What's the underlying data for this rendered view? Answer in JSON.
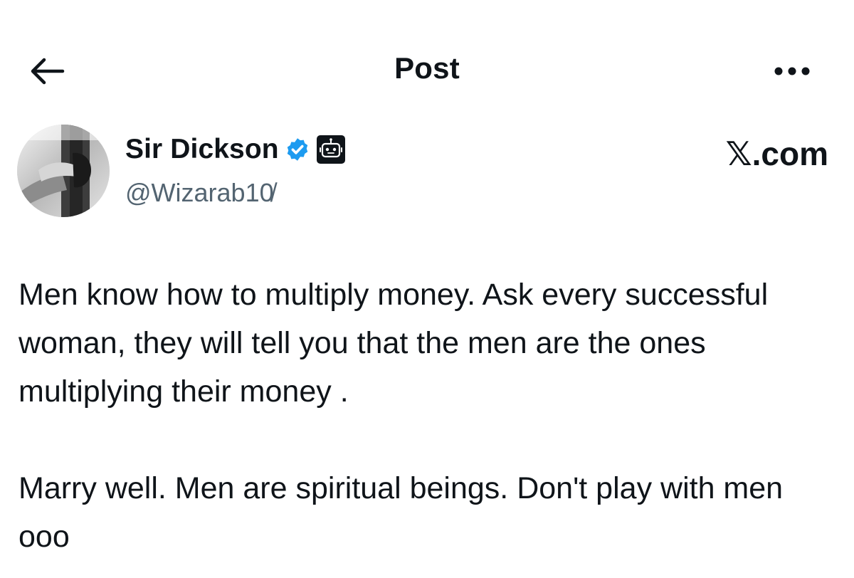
{
  "header": {
    "title": "Post",
    "back_icon": "arrow-left-icon",
    "more_icon": "more-horizontal-icon"
  },
  "author": {
    "display_name": "Sir Dickson",
    "handle": "@Wizarab10̸",
    "verified_icon": "verified-badge-icon",
    "bot_icon": "automated-account-icon",
    "avatar": "profile-photo",
    "source": "𝕏.com"
  },
  "post": {
    "paragraph_1": "Men know how to multiply money. Ask every successful woman, they will tell you that the men are the ones multiplying their money .",
    "paragraph_2": "Marry well. Men are spiritual beings. Don't play with men ooo"
  },
  "colors": {
    "text": "#0f1419",
    "secondary_text": "#536471",
    "verified_blue": "#1d9bf0",
    "background": "#ffffff"
  }
}
